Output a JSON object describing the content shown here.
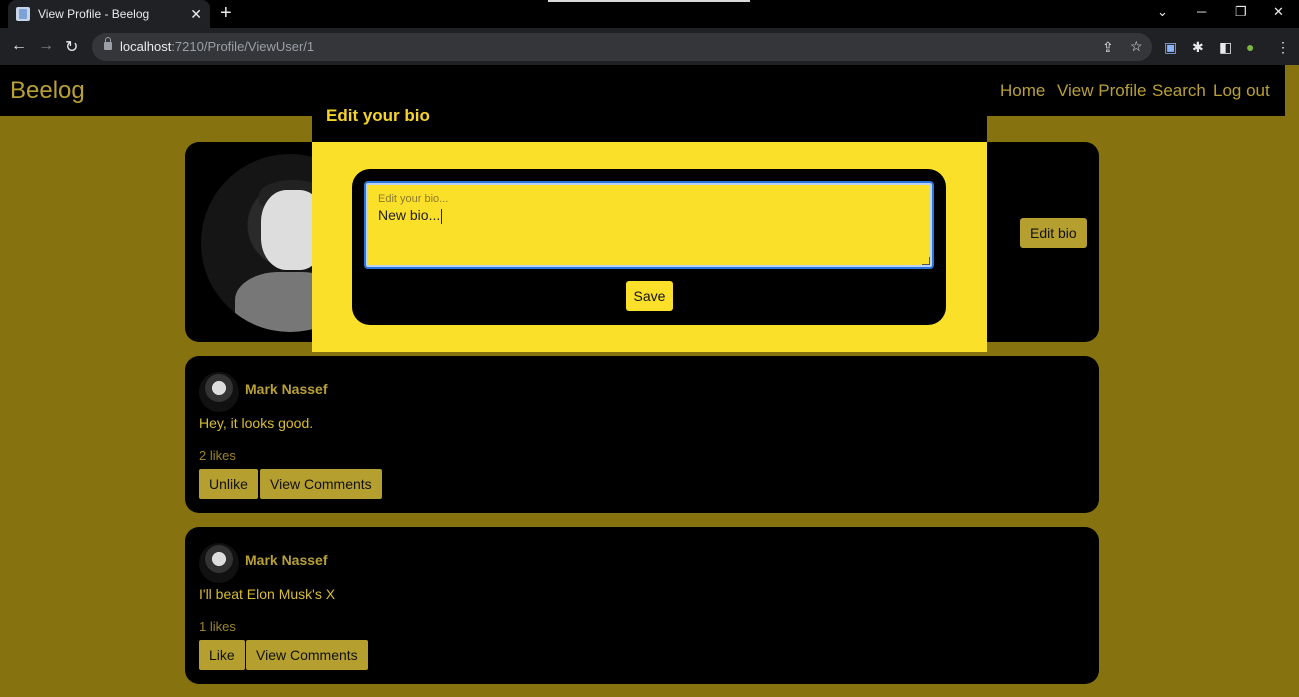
{
  "browser": {
    "tab_title": "View Profile - Beelog",
    "url_host": "localhost",
    "url_path": ":7210/Profile/ViewUser/1",
    "icons": [
      "back-icon",
      "forward-icon",
      "reload-icon",
      "lock-icon",
      "share-icon",
      "star-icon",
      "translate-icon",
      "extensions-icon",
      "sidebar-icon",
      "profile-icon",
      "menu-icon"
    ]
  },
  "site": {
    "brand": "Beelog",
    "nav": {
      "home": "Home",
      "view_profile": "View Profile",
      "search": "Search",
      "log_out": "Log out"
    }
  },
  "profile": {
    "edit_bio_label": "Edit bio"
  },
  "modal": {
    "title": "Edit your bio",
    "placeholder": "Edit your bio...",
    "value": "New bio...",
    "save_label": "Save"
  },
  "posts": [
    {
      "author": "Mark Nassef",
      "text": "Hey, it looks good.",
      "likes": "2 likes",
      "like_label": "Unlike",
      "comments_label": "View Comments"
    },
    {
      "author": "Mark Nassef",
      "text": "I'll beat Elon Musk's X",
      "likes": "1 likes",
      "like_label": "Like",
      "comments_label": "View Comments"
    }
  ],
  "colors": {
    "page_bg": "#86720f",
    "accent": "#fbe02a",
    "button": "#b59f2e",
    "header": "#000000"
  }
}
